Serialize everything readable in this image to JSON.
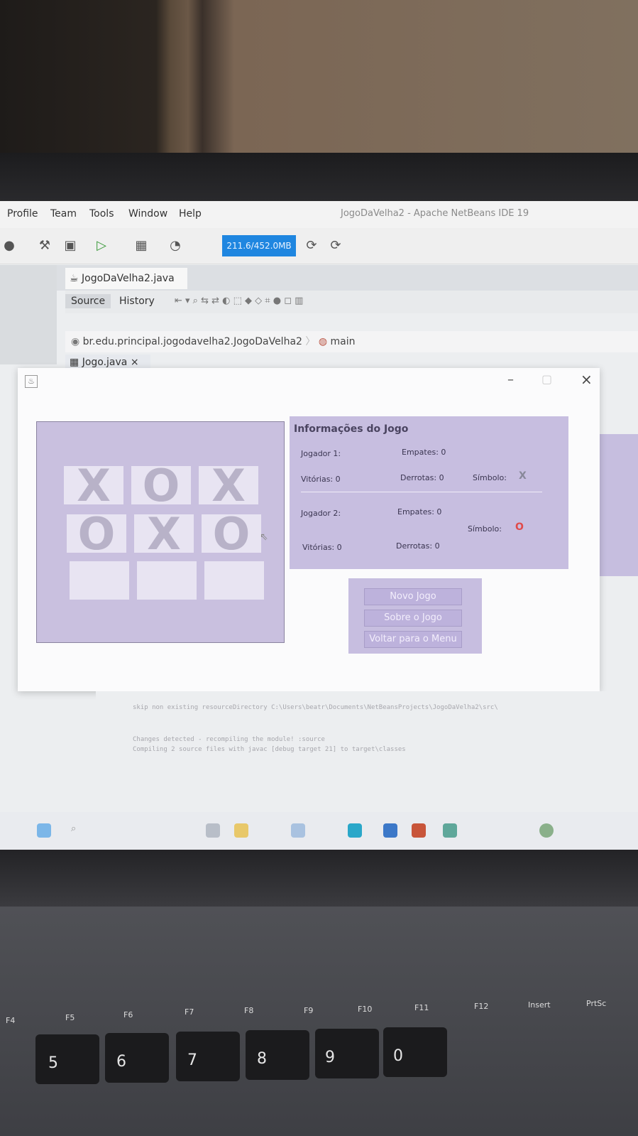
{
  "ide": {
    "menu": [
      "Profile",
      "Team",
      "Tools",
      "Window",
      "Help"
    ],
    "title": "JogoDaVelha2 - Apache NetBeans IDE 19",
    "memory": "211.6/452.0MB",
    "file_tab": "JogoDaVelha2.java",
    "editor_tabs": [
      "Source",
      "History"
    ],
    "breadcrumb": "br.edu.principal.jogodavelha2.JogoDaVelha2",
    "breadcrumb_method": "main",
    "second_tab": "Jogo.java"
  },
  "dialog": {
    "board": [
      "X",
      "O",
      "X",
      "O",
      "X",
      "O",
      "",
      "",
      ""
    ],
    "info": {
      "title": "Informações do Jogo",
      "player1_label": "Jogador 1:",
      "player1_draws": "Empates: 0",
      "player1_wins": "Vitórias: 0",
      "player1_losses": "Derrotas: 0",
      "player1_symbol_label": "Símbolo:",
      "player1_symbol": "X",
      "player2_label": "Jogador 2:",
      "player2_draws": "Empates: 0",
      "player2_symbol_label": "Símbolo:",
      "player2_symbol": "O",
      "player2_wins": "Vitórias: 0",
      "player2_losses": "Derrotas: 0"
    },
    "buttons": {
      "new_game": "Novo Jogo",
      "about": "Sobre o Jogo",
      "back": "Voltar para o Menu"
    }
  },
  "output": {
    "lines": [
      "skip non existing resourceDirectory C:\\Users\\beatr\\Documents\\NetBeansProjects\\JogoDaVelha2\\src\\",
      "Changes detected - recompiling the module! :source",
      "Compiling 2 source files with javac [debug target 21] to target\\classes"
    ]
  },
  "keyboard": {
    "fn_keys": [
      "F4",
      "F5",
      "F6",
      "F7",
      "F8",
      "F9",
      "F10",
      "F11",
      "F12",
      "Insert",
      "PrtSc"
    ],
    "number_keys": [
      "5",
      "6",
      "7",
      "8",
      "9",
      "0"
    ]
  },
  "colors": {
    "memory_bar": "#1f86e0",
    "panel_lavender": "#c7bee0",
    "symbol_x": "#888899",
    "symbol_o": "#e04b4b"
  }
}
